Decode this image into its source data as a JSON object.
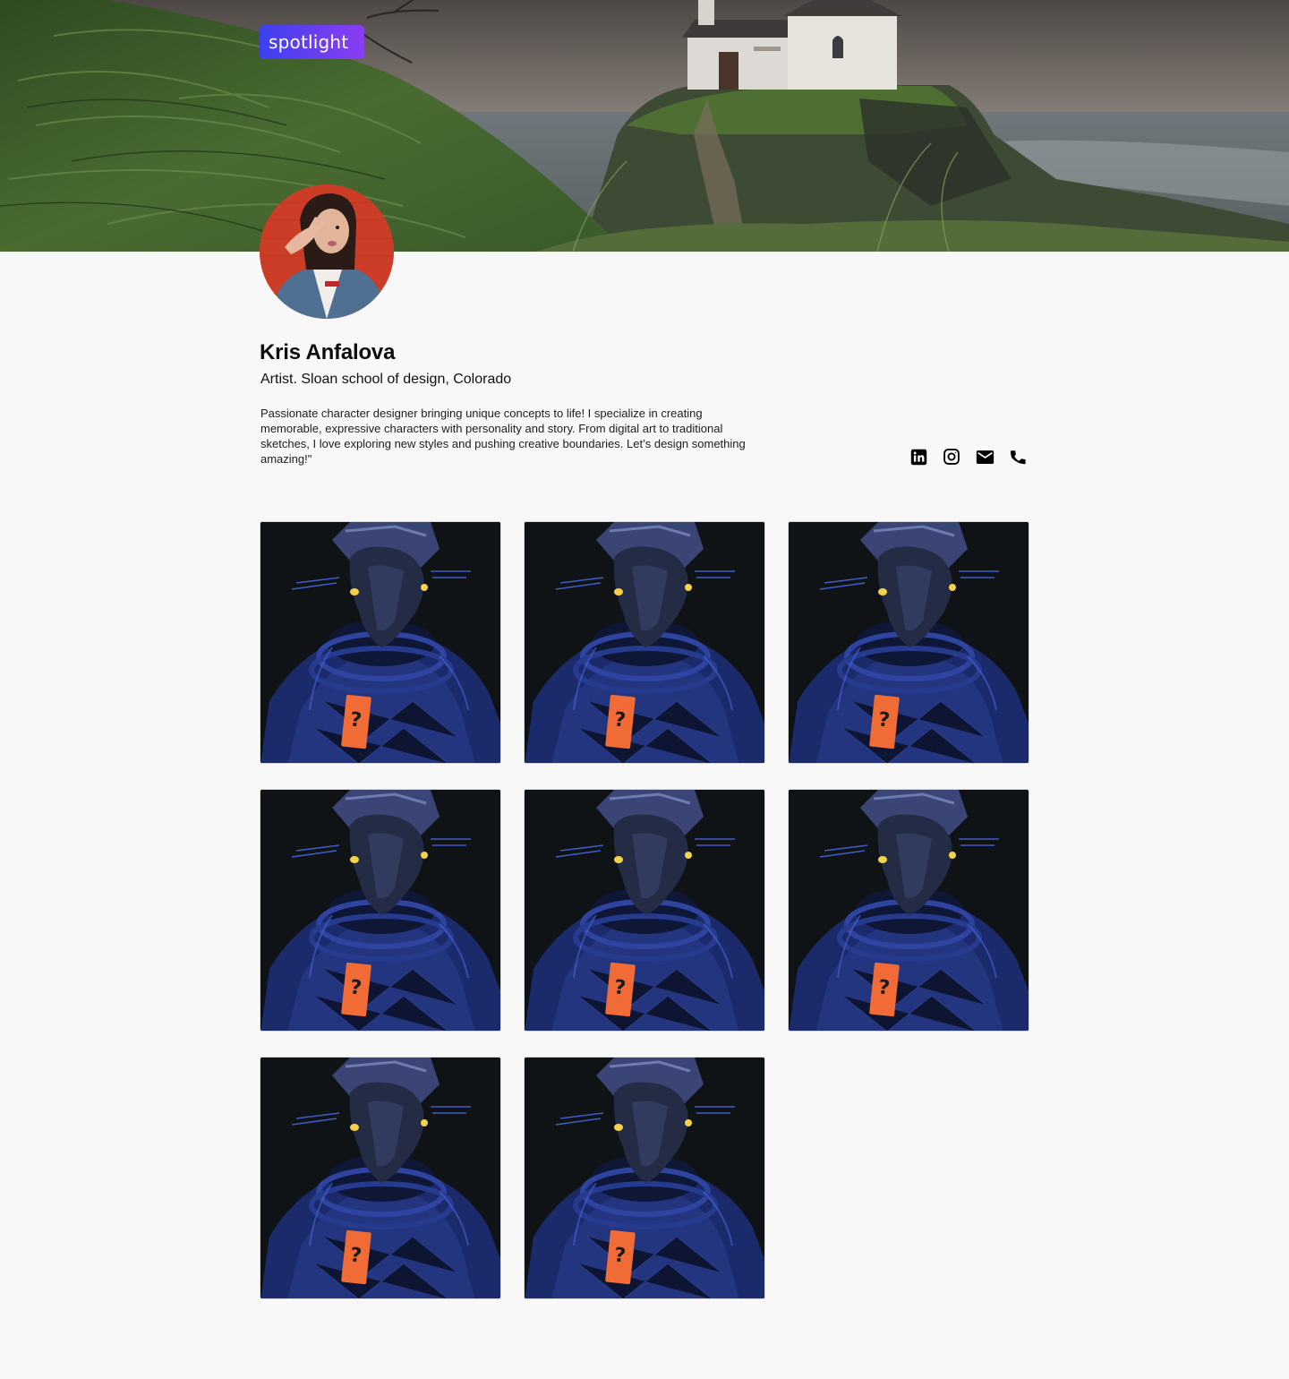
{
  "brand": {
    "name": "spotlight"
  },
  "profile": {
    "name": "Kris Anfalova",
    "title": "Artist. Sloan school of design, Colorado",
    "bio": "Passionate character designer bringing unique concepts to life! I specialize in creating memorable, expressive characters with personality and story. From digital art to traditional sketches, I love exploring new styles and pushing creative boundaries. Let’s design something amazing!\""
  },
  "social": [
    {
      "icon": "linkedin-icon"
    },
    {
      "icon": "instagram-icon"
    },
    {
      "icon": "email-icon"
    },
    {
      "icon": "phone-icon"
    }
  ],
  "gallery_count": 8,
  "colors": {
    "brand_start": "#3b41f0",
    "brand_end": "#8a3ef2",
    "background": "#f8f8f8"
  }
}
